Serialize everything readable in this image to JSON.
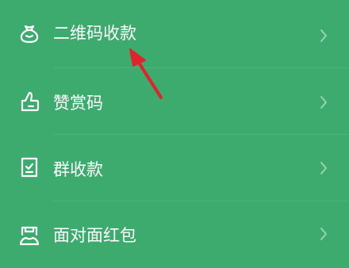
{
  "menu": {
    "items": [
      {
        "label": "二维码收款",
        "icon": "money-bag-icon"
      },
      {
        "label": "赞赏码",
        "icon": "thumbs-up-icon"
      },
      {
        "label": "群收款",
        "icon": "group-receipt-icon"
      },
      {
        "label": "面对面红包",
        "icon": "red-packet-icon"
      }
    ],
    "chevron_icon": "chevron-right-icon"
  },
  "annotation": {
    "icon": "red-arrow-icon",
    "color": "#e0242a"
  },
  "colors": {
    "background": "#3dab6e",
    "text": "#ffffff"
  }
}
